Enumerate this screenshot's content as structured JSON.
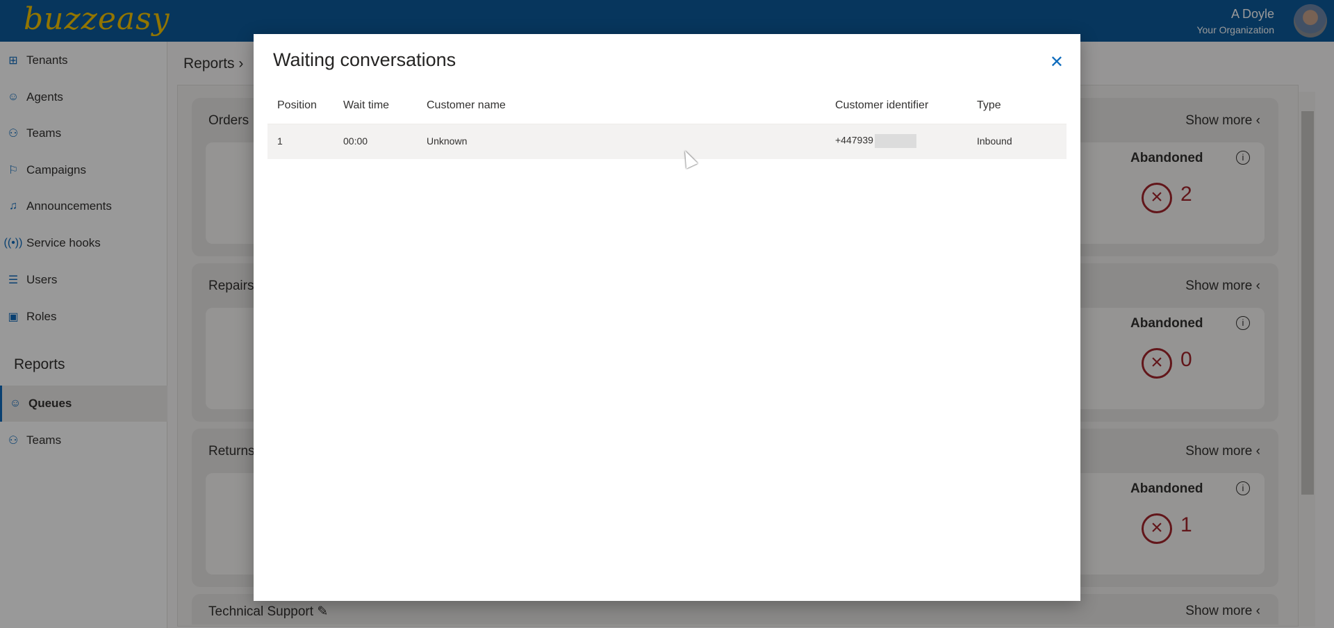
{
  "header": {
    "logo": "buzzeasy",
    "user_name": "A Doyle",
    "org": "Your Organization"
  },
  "sidebar": {
    "items": [
      {
        "label": "Tenants",
        "icon": "org-chart-icon"
      },
      {
        "label": "Agents",
        "icon": "headset-person-icon"
      },
      {
        "label": "Teams",
        "icon": "people-team-icon"
      },
      {
        "label": "Campaigns",
        "icon": "flag-icon"
      },
      {
        "label": "Announcements",
        "icon": "music-note-icon"
      },
      {
        "label": "Service hooks",
        "icon": "broadcast-icon"
      },
      {
        "label": "Users",
        "icon": "person-list-icon"
      },
      {
        "label": "Roles",
        "icon": "contact-card-settings-icon"
      }
    ],
    "reports_heading": "Reports",
    "report_items": [
      {
        "label": "Queues",
        "icon": "headset-person-icon",
        "active": true
      },
      {
        "label": "Teams",
        "icon": "people-team-icon"
      }
    ]
  },
  "main": {
    "breadcrumb": "Reports",
    "cards": [
      {
        "title": "Orders",
        "show_more": "Show more",
        "abandoned_label": "Abandoned",
        "abandoned": "2"
      },
      {
        "title": "Repairs",
        "show_more": "Show more",
        "abandoned_label": "Abandoned",
        "abandoned": "0"
      },
      {
        "title": "Returns",
        "show_more": "Show more",
        "abandoned_label": "Abandoned",
        "abandoned": "1"
      },
      {
        "title": "Technical Support",
        "show_more": "Show more"
      }
    ]
  },
  "modal": {
    "title": "Waiting conversations",
    "columns": [
      "Position",
      "Wait time",
      "Customer name",
      "Customer identifier",
      "Type"
    ],
    "rows": [
      {
        "position": "1",
        "wait_time": "00:00",
        "customer_name": "Unknown",
        "customer_identifier": "+447939",
        "type": "Inbound"
      }
    ]
  },
  "colors": {
    "brand": "#0d5a9c",
    "logo": "#f4c400",
    "abandoned": "#a4262c",
    "accent": "#0f6cbd"
  }
}
